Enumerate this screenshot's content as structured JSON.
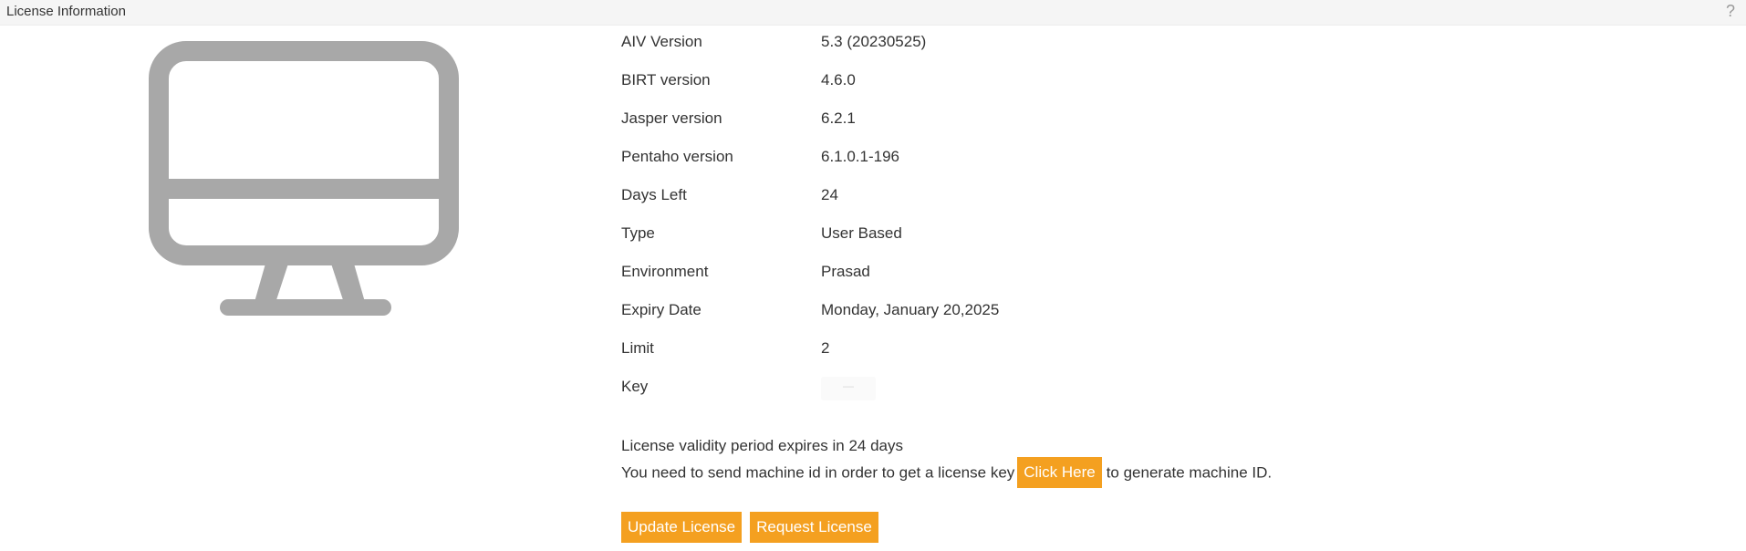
{
  "window": {
    "title": "License Information",
    "help_glyph": "?"
  },
  "icon": "monitor-icon",
  "colors": {
    "accent": "#f4a020",
    "icon_gray": "#a8a8a8"
  },
  "info_rows": [
    {
      "label": "AIV Version",
      "value": "5.3 (20230525)"
    },
    {
      "label": "BIRT version",
      "value": "4.6.0"
    },
    {
      "label": "Jasper version",
      "value": "6.2.1"
    },
    {
      "label": "Pentaho version",
      "value": "6.1.0.1-196"
    },
    {
      "label": "Days Left",
      "value": "24"
    },
    {
      "label": "Type",
      "value": "User Based"
    },
    {
      "label": "Environment",
      "value": "Prasad"
    },
    {
      "label": "Expiry Date",
      "value": "Monday, January 20,2025"
    },
    {
      "label": "Limit",
      "value": "2"
    },
    {
      "label": "Key",
      "value": "—"
    }
  ],
  "messages": {
    "validity": "License validity period expires in 24 days",
    "machine_prefix": "You need to send machine id in order to get a license key",
    "click_here": "Click Here",
    "machine_suffix": "to generate machine ID."
  },
  "buttons": {
    "update_license": "Update License",
    "request_license": "Request License"
  }
}
